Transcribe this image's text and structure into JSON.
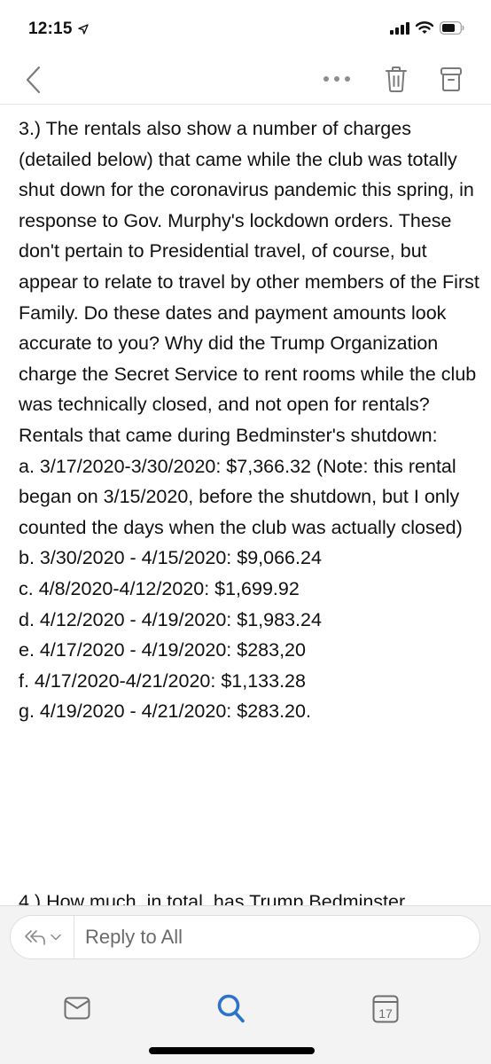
{
  "status_bar": {
    "time": "12:15",
    "location_icon": "location-arrow-icon",
    "signal_icon": "cellular-signal-icon",
    "wifi_icon": "wifi-icon",
    "battery_icon": "battery-icon"
  },
  "toolbar": {
    "back_icon": "chevron-left-icon",
    "more_icon": "ellipsis-icon",
    "delete_icon": "trash-icon",
    "archive_icon": "archive-icon"
  },
  "email": {
    "paragraph_3": "3.) The rentals also show a number of charges (detailed below) that came while the club was totally shut down for the coronavirus pandemic this spring, in response to Gov. Murphy's lockdown orders. These don't pertain to Presidential travel, of course, but appear to relate to travel by other members of the First Family. Do these dates and payment amounts look accurate to you? Why did the Trump Organization charge the Secret Service to rent rooms while the club was technically closed, and not open for rentals?",
    "rentals_heading": "Rentals that came during Bedminster's shutdown:",
    "rentals": [
      "a. 3/17/2020-3/30/2020: $7,366.32 (Note: this rental began on 3/15/2020, before the shutdown, but I only counted the days when the club was actually closed)",
      "b. 3/30/2020 - 4/15/2020: $9,066.24",
      "c. 4/8/2020-4/12/2020: $1,699.92",
      "d. 4/12/2020 - 4/19/2020: $1,983.24",
      "e. 4/17/2020 - 4/19/2020: $283,20",
      "f. 4/17/2020-4/21/2020: $1,133.28",
      "g.  4/19/2020 - 4/21/2020: $283.20."
    ],
    "paragraph_4_start": "4.) How much, in total, has Trump Bedminster"
  },
  "reply": {
    "mode_icon": "reply-all-icon",
    "dropdown_icon": "chevron-down-icon",
    "placeholder": "Reply to All"
  },
  "tabbar": {
    "mail_icon": "mail-icon",
    "search_icon": "search-icon",
    "calendar_icon": "calendar-icon",
    "calendar_day": "17",
    "active_color": "#2f73c9",
    "inactive_color": "#6e6e6e"
  }
}
